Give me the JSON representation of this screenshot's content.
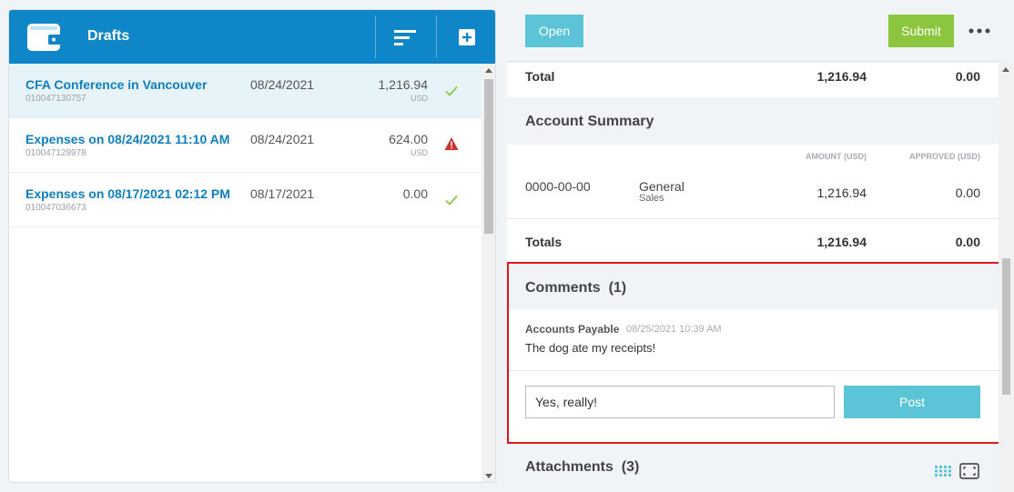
{
  "drafts_panel": {
    "title": "Drafts",
    "items": [
      {
        "title": "CFA Conference in Vancouver",
        "id": "010047130757",
        "date": "08/24/2021",
        "amount": "1,216.94",
        "currency": "USD",
        "status": "ok"
      },
      {
        "title": "Expenses on 08/24/2021 11:10 AM",
        "id": "010047129978",
        "date": "08/24/2021",
        "amount": "624.00",
        "currency": "USD",
        "status": "warning"
      },
      {
        "title": "Expenses on 08/17/2021 02:12 PM",
        "id": "010047036673",
        "date": "08/17/2021",
        "amount": "0.00",
        "currency": "",
        "status": "ok"
      }
    ]
  },
  "toolbar": {
    "open_label": "Open",
    "submit_label": "Submit"
  },
  "total_row": {
    "label": "Total",
    "amount": "1,216.94",
    "approved": "0.00"
  },
  "account_summary": {
    "title": "Account Summary",
    "col_amount": "AMOUNT (USD)",
    "col_approved": "APPROVED (USD)",
    "row": {
      "code": "0000-00-00",
      "name": "General",
      "sub": "Sales",
      "amount": "1,216.94",
      "approved": "0.00"
    },
    "totals_label": "Totals",
    "totals_amount": "1,216.94",
    "totals_approved": "0.00"
  },
  "comments": {
    "title": "Comments  (1)",
    "author": "Accounts Payable",
    "timestamp": "08/25/2021 10:39 AM",
    "text": "The dog ate my receipts!",
    "input_value": "Yes, really!",
    "post_label": "Post"
  },
  "attachments": {
    "title": "Attachments  (3)"
  },
  "colors": {
    "header_blue": "#0f86c8",
    "accent_cyan": "#5bc4d6",
    "submit_green": "#8cc63f",
    "highlight_red": "#e3161b",
    "check_green": "#8cc63f",
    "warning_red": "#d0312d"
  }
}
